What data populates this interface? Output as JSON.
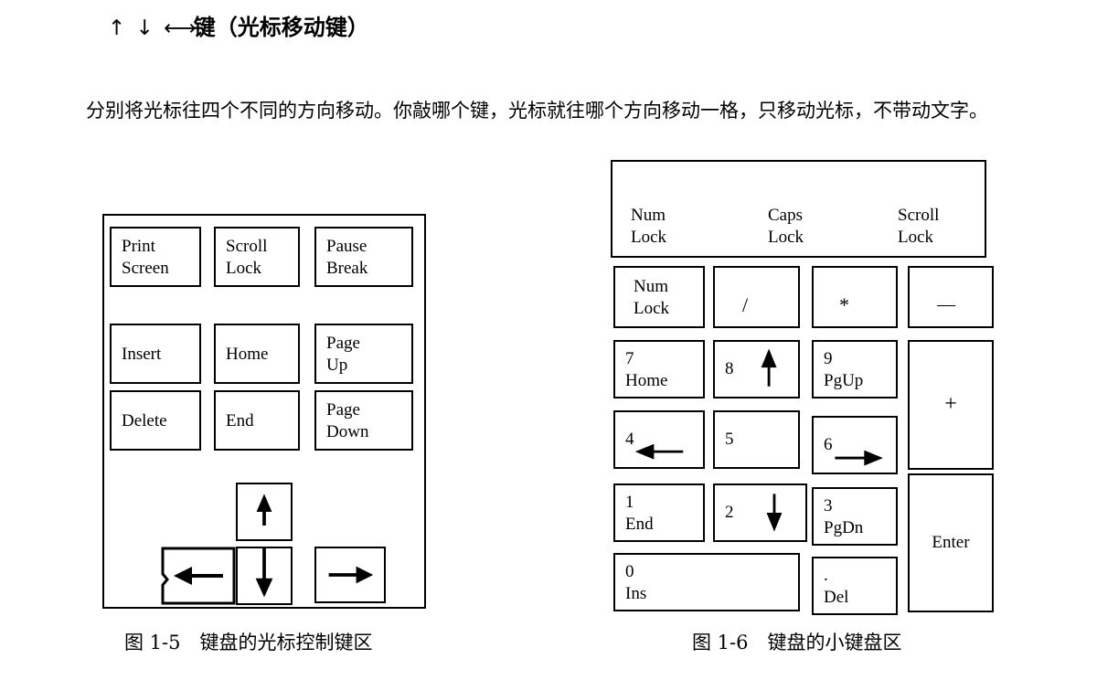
{
  "heading": {
    "arrows": "↑ ↓ ",
    "arrows_lr": "←→",
    "text": "键（光标移动键）"
  },
  "paragraph": "分别将光标往四个不同的方向移动。你敲哪个键，光标就往哪个方向移动一格，只移动光标，不带动文字。",
  "figure5": {
    "caption": "图 1-5　键盘的光标控制键区",
    "keys": [
      {
        "id": "print-screen",
        "label": "Print\nScreen"
      },
      {
        "id": "scroll-lock",
        "label": "Scroll\nLock"
      },
      {
        "id": "pause-break",
        "label": "Pause\nBreak"
      },
      {
        "id": "insert",
        "label": "Insert"
      },
      {
        "id": "home",
        "label": "Home"
      },
      {
        "id": "page-up",
        "label": "Page\nUp"
      },
      {
        "id": "delete",
        "label": "Delete"
      },
      {
        "id": "end",
        "label": "End"
      },
      {
        "id": "page-down",
        "label": "Page\nDown"
      },
      {
        "id": "arrow-up",
        "label": ""
      },
      {
        "id": "arrow-left",
        "label": ""
      },
      {
        "id": "arrow-down",
        "label": ""
      },
      {
        "id": "arrow-right",
        "label": ""
      }
    ]
  },
  "figure6": {
    "caption": "图 1-6　键盘的小键盘区",
    "indicators": [
      {
        "id": "num-lock-led",
        "label": "Num\nLock"
      },
      {
        "id": "caps-lock-led",
        "label": "Caps\nLock"
      },
      {
        "id": "scroll-lock-led",
        "label": "Scroll\nLock"
      }
    ],
    "keys": [
      {
        "id": "num-lock",
        "label": "Num\nLock"
      },
      {
        "id": "divide",
        "label": "/"
      },
      {
        "id": "multiply",
        "label": "*"
      },
      {
        "id": "minus",
        "label": "—"
      },
      {
        "id": "num-7",
        "label": "7\nHome"
      },
      {
        "id": "num-8",
        "label": "8"
      },
      {
        "id": "num-9",
        "label": "9\nPgUp"
      },
      {
        "id": "plus",
        "label": "+"
      },
      {
        "id": "num-4",
        "label": "4"
      },
      {
        "id": "num-5",
        "label": "5"
      },
      {
        "id": "num-6",
        "label": "6"
      },
      {
        "id": "num-1",
        "label": "1\nEnd"
      },
      {
        "id": "num-2",
        "label": "2"
      },
      {
        "id": "num-3",
        "label": "3\nPgDn"
      },
      {
        "id": "enter",
        "label": "Enter"
      },
      {
        "id": "num-0",
        "label": "0\nIns"
      },
      {
        "id": "decimal",
        "label": ".\nDel"
      }
    ]
  },
  "colors": {
    "ink": "#000000",
    "paper": "#ffffff"
  }
}
